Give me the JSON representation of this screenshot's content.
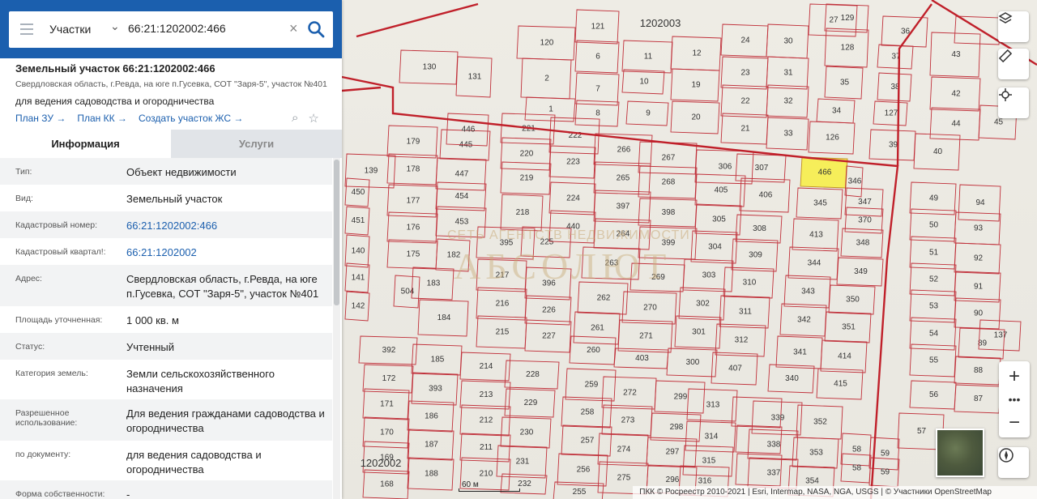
{
  "search": {
    "type_label": "Участки",
    "query": "66:21:1202002:466"
  },
  "object": {
    "title": "Земельный участок 66:21:1202002:466",
    "address_short": "Свердловская область, г.Ревда, на юге п.Гусевка, СОТ \"Заря-5\", участок №401",
    "purpose": "для ведения садоводства и огородничества",
    "links": [
      "План ЗУ",
      "План КК",
      "Создать участок ЖС"
    ]
  },
  "tabs": [
    "Информация",
    "Услуги"
  ],
  "info": [
    {
      "label": "Тип:",
      "value": "Объект недвижимости",
      "link": false
    },
    {
      "label": "Вид:",
      "value": "Земельный участок",
      "link": false
    },
    {
      "label": "Кадастровый номер:",
      "value": "66:21:1202002:466",
      "link": true
    },
    {
      "label": "Кадастровый квартал!:",
      "value": "66:21:1202002",
      "link": true
    },
    {
      "label": "Адрес:",
      "value": "Свердловская область, г.Ревда, на юге п.Гусевка, СОТ \"Заря-5\", участок №401",
      "link": false
    },
    {
      "label": "Площадь уточненная:",
      "value": "1 000 кв. м",
      "link": false
    },
    {
      "label": "Статус:",
      "value": "Учтенный",
      "link": false
    },
    {
      "label": "Категория земель:",
      "value": "Земли сельскохозяйственного назначения",
      "link": false
    },
    {
      "label": "Разрешенное использование:",
      "value": "Для ведения гражданами садоводства и огородничества",
      "link": false
    },
    {
      "label": "по документу:",
      "value": "для ведения садоводства и огородничества",
      "link": false
    },
    {
      "label": "Форма собственности:",
      "value": "-",
      "link": false
    }
  ],
  "map": {
    "quarters": [
      "1202003",
      "1202002"
    ],
    "selected_plot": "466",
    "watermark_top": "СЕТЬ АГЕНТСТВ НЕДВИЖИМОСТИ",
    "watermark_main": "АБСОЛЮТ",
    "scale_label": "60 м",
    "attribution": "ПКК © Росреестр 2010-2021 | Esri, Intermap, NASA, NGA, USGS | © Участники OpenStreetMap",
    "zoom_in": "+",
    "zoom_out": "−",
    "more": "•••",
    "plot_color": "#c0303a",
    "selected_color": "#f6ee5a"
  }
}
